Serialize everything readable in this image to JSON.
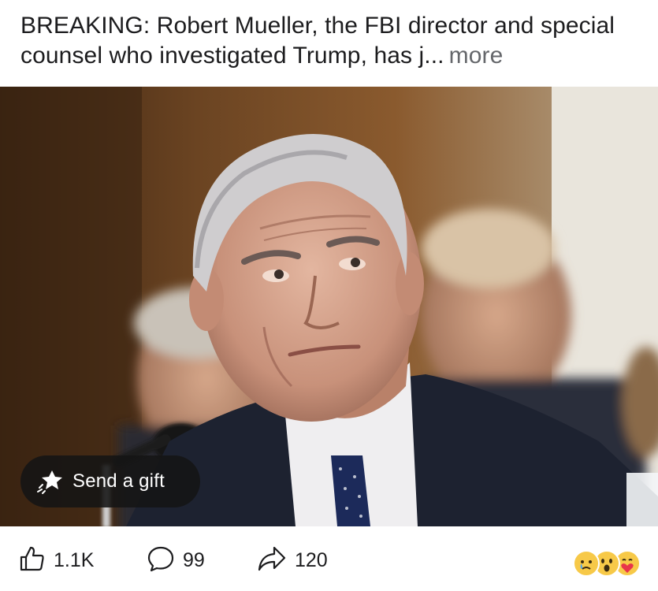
{
  "post": {
    "caption_text": "BREAKING: Robert Mueller, the FBI director and special counsel who investigated Trump, has j...",
    "more_label": "more"
  },
  "gift_button": {
    "label": "Send a gift",
    "icon": "gift-star-icon"
  },
  "actions": {
    "likes": {
      "count": "1.1K",
      "icon": "thumbs-up-icon"
    },
    "comments": {
      "count": "99",
      "icon": "comment-bubble-icon"
    },
    "shares": {
      "count": "120",
      "icon": "share-arrow-icon"
    }
  },
  "reactions": [
    "sad-face-icon",
    "surprised-face-icon",
    "hug-heart-face-icon"
  ]
}
